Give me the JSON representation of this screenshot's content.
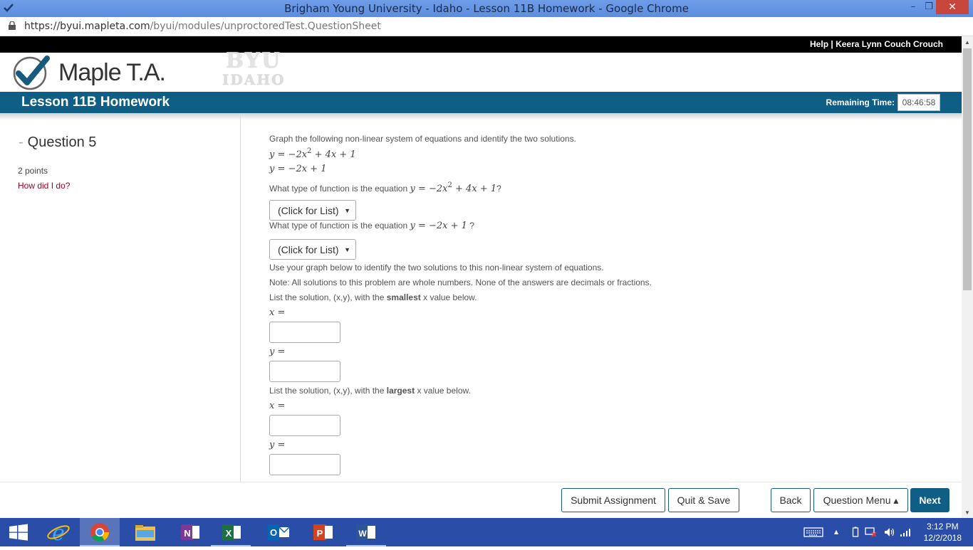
{
  "window": {
    "title": "Brigham Young University - Idaho - Lesson 11B Homework - Google Chrome",
    "minimize": "–",
    "restore": "❐",
    "close": "✕"
  },
  "address": {
    "host": "https://byui.mapleta.com",
    "path": "/byui/modules/unproctoredTest.QuestionSheet"
  },
  "topbar": {
    "help": "Help",
    "separator": "|",
    "user": "Keera Lynn Couch Crouch"
  },
  "logo": {
    "brand": "Maple T.A.",
    "school_line1": "BYU",
    "school_line2": "IDAHO"
  },
  "header": {
    "title": "Lesson 11B Homework",
    "remaining_label": "Remaining Time:",
    "remaining_value": "08:46:58"
  },
  "sidebar": {
    "dash": "-",
    "question": "Question 5",
    "points": "2 points",
    "how_did_i_do": "How did I do?"
  },
  "question": {
    "intro": "Graph the following non-linear system of equations and identify the two solutions.",
    "eq1": {
      "lhs": "y",
      "eq": "=",
      "rhs_a": "−2x",
      "exp": "2",
      "rhs_b": "+ 4x + 1"
    },
    "eq2": {
      "lhs": "y",
      "eq": "=",
      "rhs": "−2x + 1"
    },
    "q1_prefix": "What type of function is the equation",
    "q1_suffix": "?",
    "q2_prefix": "What type of function is the equation",
    "q2_suffix": "?",
    "select1_value": "(Click for List)",
    "select2_value": "(Click for List)",
    "use_graph": "Use your graph below to identify the two solutions to this non-linear system of equations.",
    "note": "Note: All solutions to this problem are whole numbers. None of the answers are decimals or fractions.",
    "list_smallest_a": "List the solution, (x,y), with the",
    "list_smallest_b": "smallest",
    "list_smallest_c": "x value below.",
    "list_largest_a": "List the solution, (x,y), with the",
    "list_largest_b": "largest",
    "list_largest_c": "x value below.",
    "x_label": "x",
    "y_label": "y",
    "eq_sign": "="
  },
  "footer": {
    "submit": "Submit Assignment",
    "quit": "Quit & Save",
    "back": "Back",
    "menu": "Question Menu ▴",
    "next": "Next"
  },
  "taskbar": {
    "time": "3:12 PM",
    "date": "12/2/2018"
  }
}
